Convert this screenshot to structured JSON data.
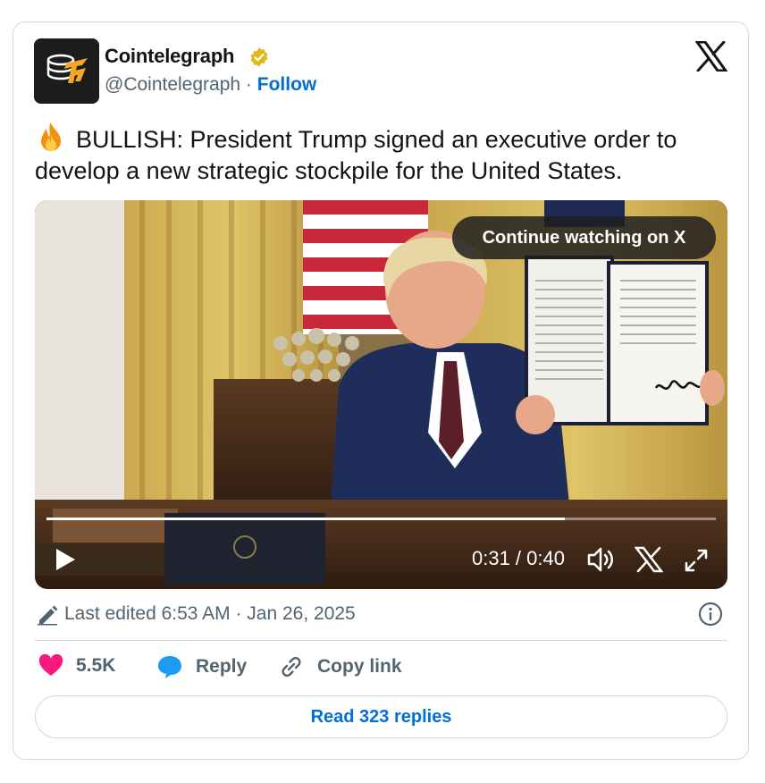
{
  "author": {
    "name": "Cointelegraph",
    "handle": "@Cointelegraph",
    "separator": "·",
    "follow_label": "Follow"
  },
  "tweet": {
    "text": "BULLISH: President Trump signed an executive order to develop a new strategic stockpile for the United States."
  },
  "video": {
    "continue_label": "Continue watching on X",
    "time": "0:31 / 0:40",
    "progress": 0.775
  },
  "meta": {
    "edited_text": "Last edited 6:53 AM · Jan 26, 2025"
  },
  "actions": {
    "likes": "5.5K",
    "reply_label": "Reply",
    "copy_link_label": "Copy link",
    "read_replies_label": "Read 323 replies"
  },
  "colors": {
    "accent": "#006fd6",
    "like": "#f91880",
    "reply_bubble": "#1d9bf0",
    "verified": "#e2b719",
    "muted": "#536471",
    "border": "#cfd9de"
  }
}
